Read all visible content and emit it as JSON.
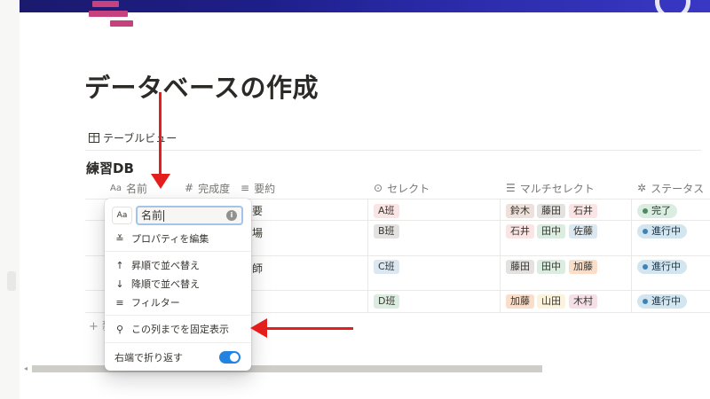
{
  "page": {
    "title": "データベースの作成"
  },
  "view": {
    "tab_label": "テーブルビュー"
  },
  "database": {
    "title": "練習DB",
    "columns": [
      {
        "label": "名前",
        "icon": "text-type-icon",
        "icon_glyph": "Aa"
      },
      {
        "label": "完成度",
        "icon": "number-icon",
        "icon_glyph": "#"
      },
      {
        "label": "要約",
        "icon": "text-lines-icon",
        "icon_glyph": "≡"
      },
      {
        "label": "セレクト",
        "icon": "select-icon",
        "icon_glyph": "⊙"
      },
      {
        "label": "マルチセレクト",
        "icon": "list-icon",
        "icon_glyph": "☰"
      },
      {
        "label": "ステータス",
        "icon": "status-icon",
        "icon_glyph": "✲"
      }
    ],
    "rows": [
      {
        "summary_fragment": "要",
        "select": "A班",
        "multi": [
          "鈴木",
          "藤田",
          "石井"
        ],
        "status": "完了"
      },
      {
        "summary_fragment": "場",
        "select": "B班",
        "multi": [
          "石井",
          "田中",
          "佐藤"
        ],
        "status": "進行中"
      },
      {
        "summary_fragment": "師",
        "select": "C班",
        "multi": [
          "藤田",
          "田中",
          "加藤"
        ],
        "status": "進行中"
      },
      {
        "summary_fragment": "",
        "select": "D班",
        "multi": [
          "加藤",
          "山田",
          "木村"
        ],
        "status": "進行中"
      }
    ],
    "new_row_glyph": "+ 新"
  },
  "menu": {
    "type_button": "Aa",
    "name_value": "名前",
    "info_glyph": "i",
    "items": {
      "edit_property": "プロパティを編集",
      "sort_asc": "昇順で並べ替え",
      "sort_desc": "降順で並べ替え",
      "filter": "フィルター",
      "freeze": "この列までを固定表示",
      "wrap": "右端で折り返す"
    },
    "icons": {
      "edit_property": "≚",
      "sort_asc": "↑",
      "sort_desc": "↓",
      "filter": "≡",
      "freeze": "⚲"
    },
    "wrap_enabled": true
  },
  "colors": {
    "annotation_arrow": "#e41d1d",
    "toggle_on": "#2383e2",
    "page_icon": "#c5427e"
  }
}
